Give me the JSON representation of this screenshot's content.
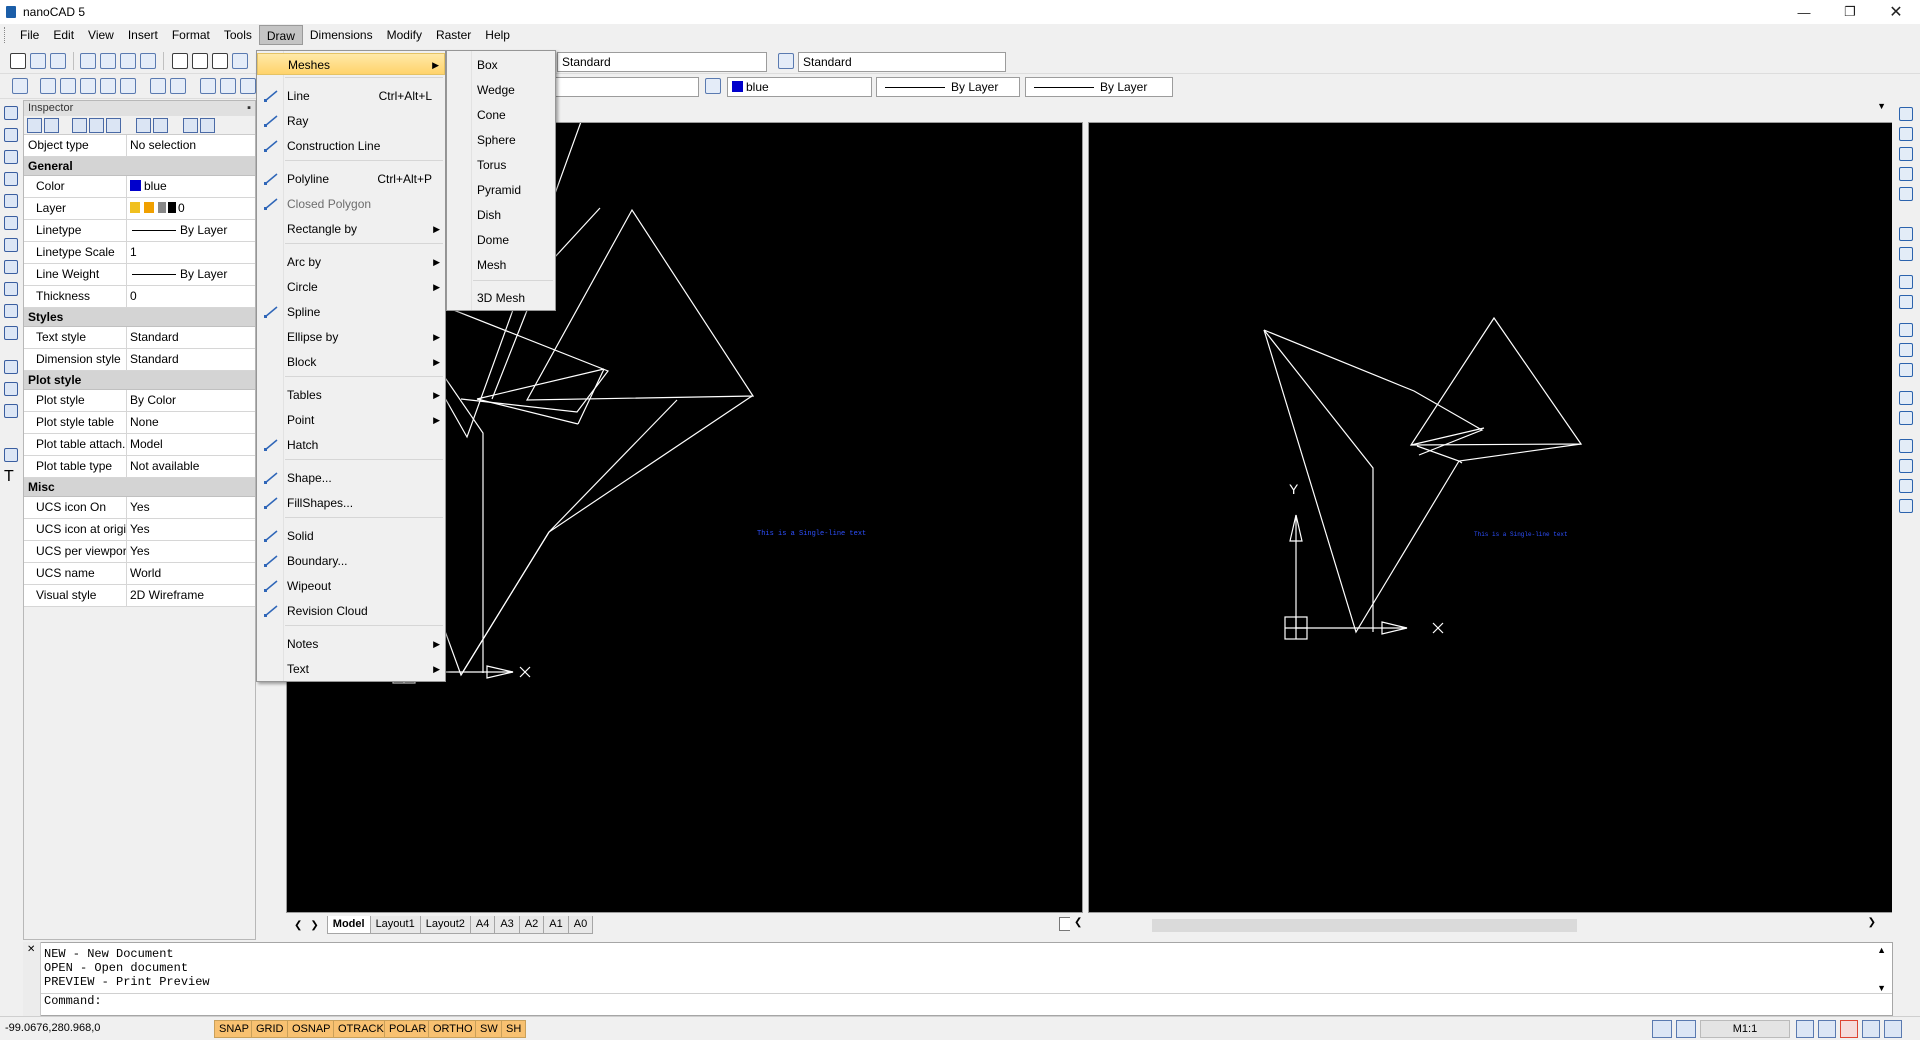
{
  "window": {
    "title": "nanoCAD 5"
  },
  "menubar": {
    "items": [
      "File",
      "Edit",
      "View",
      "Insert",
      "Format",
      "Tools",
      "Draw",
      "Dimensions",
      "Modify",
      "Raster",
      "Help"
    ],
    "active": "Draw"
  },
  "toolbar": {
    "text_style": "Standard",
    "dim_style": "Standard",
    "color": "blue",
    "linetype": "By Layer",
    "lineweight": "By Layer"
  },
  "inspector": {
    "title": "Inspector",
    "object_type_label": "Object type",
    "object_type_value": "No selection",
    "sections": [
      {
        "name": "General",
        "rows": [
          {
            "k": "Color",
            "v": "blue"
          },
          {
            "k": "Layer",
            "v": "0"
          },
          {
            "k": "Linetype",
            "v": "By Layer"
          },
          {
            "k": "Linetype Scale",
            "v": "1"
          },
          {
            "k": "Line Weight",
            "v": "By Layer"
          },
          {
            "k": "Thickness",
            "v": "0"
          }
        ]
      },
      {
        "name": "Styles",
        "rows": [
          {
            "k": "Text style",
            "v": "Standard"
          },
          {
            "k": "Dimension style",
            "v": "Standard"
          }
        ]
      },
      {
        "name": "Plot style",
        "rows": [
          {
            "k": "Plot style",
            "v": "By Color"
          },
          {
            "k": "Plot style table",
            "v": "None"
          },
          {
            "k": "Plot table attach...",
            "v": "Model"
          },
          {
            "k": "Plot table type",
            "v": "Not available"
          }
        ]
      },
      {
        "name": "Misc",
        "rows": [
          {
            "k": "UCS icon On",
            "v": "Yes"
          },
          {
            "k": "UCS icon at origin",
            "v": "Yes"
          },
          {
            "k": "UCS per viewport",
            "v": "Yes"
          },
          {
            "k": "UCS name",
            "v": "World"
          },
          {
            "k": "Visual style",
            "v": "2D Wireframe"
          }
        ]
      }
    ]
  },
  "draw_menu": {
    "items": [
      {
        "label": "Meshes",
        "submenu": true,
        "highlight": true
      },
      {
        "label": "Line",
        "shortcut": "Ctrl+Alt+L"
      },
      {
        "label": "Ray"
      },
      {
        "label": "Construction Line"
      },
      {
        "label": "Polyline",
        "shortcut": "Ctrl+Alt+P"
      },
      {
        "label": "Closed Polygon"
      },
      {
        "label": "Rectangle by",
        "submenu": true
      },
      {
        "label": "Arc by",
        "submenu": true
      },
      {
        "label": "Circle",
        "submenu": true
      },
      {
        "label": "Spline"
      },
      {
        "label": "Ellipse by",
        "submenu": true
      },
      {
        "label": "Block",
        "submenu": true
      },
      {
        "label": "Tables",
        "submenu": true
      },
      {
        "label": "Point",
        "submenu": true
      },
      {
        "label": "Hatch"
      },
      {
        "label": "Shape..."
      },
      {
        "label": "FillShapes..."
      },
      {
        "label": "Solid"
      },
      {
        "label": "Boundary..."
      },
      {
        "label": "Wipeout"
      },
      {
        "label": "Revision Cloud"
      },
      {
        "label": "Notes",
        "submenu": true
      },
      {
        "label": "Text",
        "submenu": true
      }
    ]
  },
  "meshes_menu": {
    "items": [
      "Box",
      "Wedge",
      "Cone",
      "Sphere",
      "Torus",
      "Pyramid",
      "Dish",
      "Dome",
      "Mesh",
      "3D Mesh"
    ]
  },
  "viewport": {
    "text_label": "This is a Single-line text",
    "axis_y": "Y",
    "axis_x": "X"
  },
  "layout_tabs": [
    "Model",
    "Layout1",
    "Layout2",
    "A4",
    "A3",
    "A2",
    "A1",
    "A0"
  ],
  "command": {
    "history": [
      "NEW - New Document",
      "OPEN - Open document",
      "PREVIEW - Print Preview"
    ],
    "prompt": "Command:"
  },
  "status": {
    "coords": "-99.0676,280.968,0",
    "buttons": [
      "SNAP",
      "GRID",
      "OSNAP",
      "OTRACK",
      "POLAR",
      "ORTHO",
      "SW",
      "SH"
    ],
    "scale": "M1:1"
  },
  "colors": {
    "accent_highlight": "#ffd36b",
    "status_on": "#f8c171",
    "entity_color": "#0000cc",
    "canvas": "#000000"
  }
}
